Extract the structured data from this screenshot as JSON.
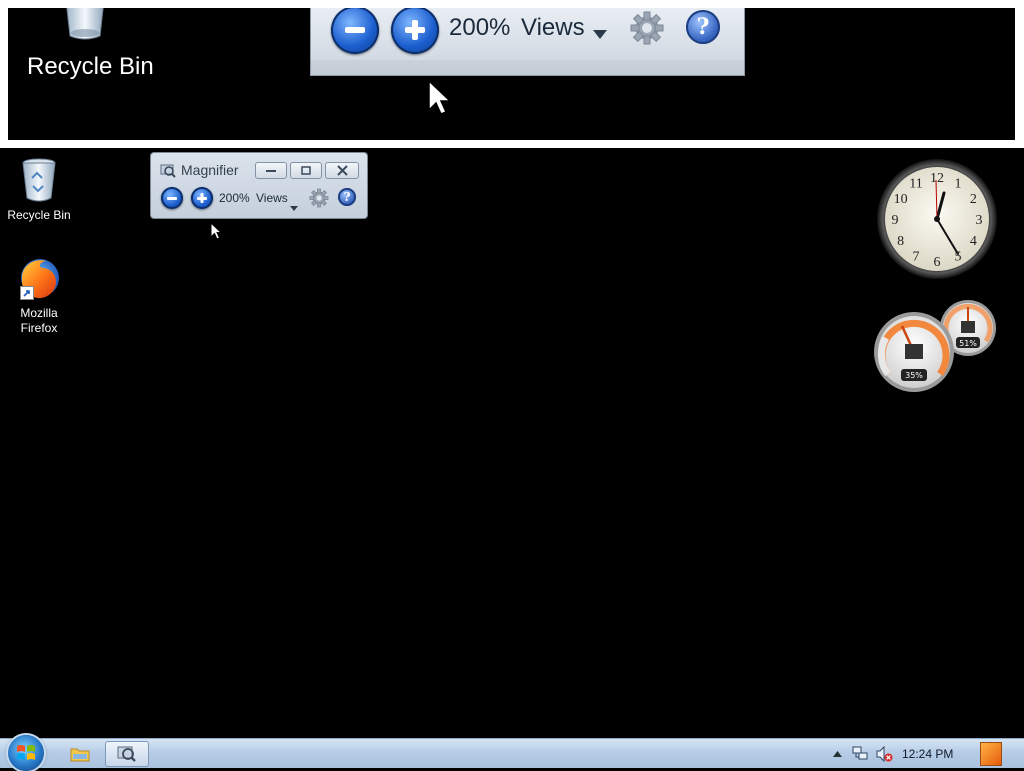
{
  "lens": {
    "recycle_bin_label": "Recycle Bin",
    "zoom_level": "200%",
    "views_label": "Views"
  },
  "desktop": {
    "icons": [
      {
        "label": "Recycle Bin",
        "icon": "recycle-bin-icon"
      },
      {
        "label_line1": "Mozilla",
        "label_line2": "Firefox",
        "icon": "firefox-icon"
      }
    ]
  },
  "magnifier": {
    "title": "Magnifier",
    "zoom_level": "200%",
    "views_label": "Views",
    "zoom_out_icon": "minus-icon",
    "zoom_in_icon": "plus-icon",
    "options_icon": "gear-icon",
    "help_icon": "help-icon"
  },
  "gadgets": {
    "clock_numbers": [
      "12",
      "1",
      "2",
      "3",
      "4",
      "5",
      "6",
      "7",
      "8",
      "9",
      "10",
      "11"
    ],
    "cpu_meter": {
      "cpu_value": "35%",
      "memory_value": "51%",
      "cpu_level": 0.35,
      "memory_level": 0.51
    }
  },
  "taskbar": {
    "time": "12:24 PM",
    "accent": "#2778c8"
  }
}
